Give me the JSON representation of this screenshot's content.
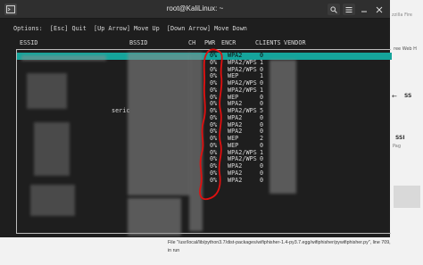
{
  "window": {
    "title": "root@KaliLinux: ~"
  },
  "options_line": "Options:  [Esc] Quit  [Up Arrow] Move Up  [Down Arrow] Move Down",
  "headers": {
    "essid": "ESSID",
    "bssid": "BSSID",
    "ch": "CH",
    "pwr": "PWR",
    "encr": "ENCR",
    "clients": "CLIENTS",
    "vendor": "VENDOR"
  },
  "rows": [
    {
      "pwr": "0%",
      "encr": "WPA2",
      "clients": "0",
      "selected": true
    },
    {
      "pwr": "0%",
      "encr": "WPA2/WPS",
      "clients": "1"
    },
    {
      "pwr": "0%",
      "encr": "WPA2/WPS",
      "clients": "0"
    },
    {
      "pwr": "0%",
      "encr": "WEP",
      "clients": "1"
    },
    {
      "pwr": "0%",
      "encr": "WPA2/WPS",
      "clients": "0"
    },
    {
      "pwr": "0%",
      "encr": "WPA2/WPS",
      "clients": "1"
    },
    {
      "pwr": "0%",
      "encr": "WEP",
      "clients": "0"
    },
    {
      "pwr": "0%",
      "encr": "WPA2",
      "clients": "0"
    },
    {
      "pwr": "0%",
      "encr": "WPA2/WPS",
      "clients": "5",
      "essid_fragment": "seric"
    },
    {
      "pwr": "0%",
      "encr": "WPA2",
      "clients": "0"
    },
    {
      "pwr": "0%",
      "encr": "WPA2",
      "clients": "0"
    },
    {
      "pwr": "0%",
      "encr": "WPA2",
      "clients": "0"
    },
    {
      "pwr": "0%",
      "encr": "WEP",
      "clients": "2"
    },
    {
      "pwr": "0%",
      "encr": "WEP",
      "clients": "0"
    },
    {
      "pwr": "0%",
      "encr": "WPA2/WPS",
      "clients": "1"
    },
    {
      "pwr": "0%",
      "encr": "WPA2/WPS",
      "clients": "0"
    },
    {
      "pwr": "0%",
      "encr": "WPA2",
      "clients": "0"
    },
    {
      "pwr": "0%",
      "encr": "WPA2",
      "clients": "0"
    },
    {
      "pwr": "0%",
      "encr": "WPA2",
      "clients": "0"
    }
  ],
  "background": {
    "right_frag_top": "zzilla Fire",
    "right_frag_web": "ree Web H",
    "right_frag_s": "SS",
    "right_frag_arrow": "←",
    "right_frag_rt": "SSI",
    "right_frag_page": "Pag",
    "right_frag_tiny": "— —",
    "file_line": "File \"/usr/local/lib/python3.7/dist-packages/wifiphisher-1.4-py3.7.egg/wifiphisher/pywifiphisher.py\", line 709,",
    "in_run": "in run"
  },
  "colors": {
    "highlight": "#15a49b",
    "annotation": "#e01010"
  }
}
